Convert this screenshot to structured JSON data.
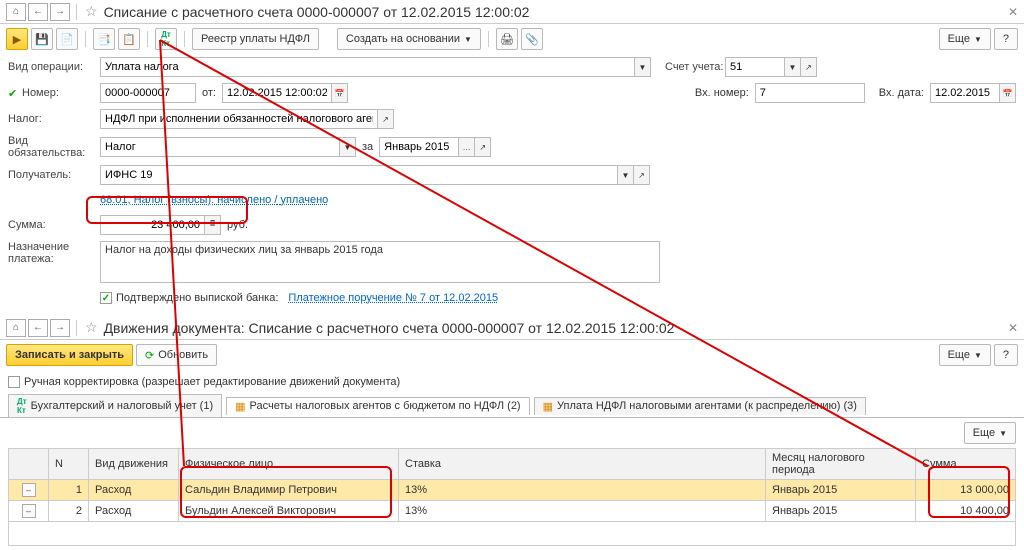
{
  "top": {
    "title": "Списание с расчетного счета 0000-000007 от 12.02.2015 12:00:02",
    "toolbar_registry": "Реестр уплаты НДФЛ",
    "toolbar_create": "Создать на основании",
    "more": "Еще",
    "help": "?",
    "op_type_label": "Вид операции:",
    "op_type_value": "Уплата налога",
    "account_label": "Счет учета:",
    "account_value": "51",
    "number_label": "Номер:",
    "number_value": "0000-000007",
    "date_label": "от:",
    "date_value": "12.02.2015 12:00:02",
    "in_number_label": "Вх. номер:",
    "in_number_value": "7",
    "in_date_label": "Вх. дата:",
    "in_date_value": "12.02.2015",
    "tax_label": "Налог:",
    "tax_value": "НДФЛ при исполнении обязанностей налогового агента",
    "liab_label": "Вид обязательства:",
    "liab_value": "Налог",
    "period_label": "за",
    "period_value": "Январь 2015",
    "recipient_label": "Получатель:",
    "recipient_value": "ИФНС 19",
    "account_link_pre": "68.01, Налог (взносы): начислено /",
    "account_link_suf": "уплачено",
    "sum_label": "Сумма:",
    "sum_value": "23 400,00",
    "rub": "руб.",
    "purpose_label": "Назначение платежа:",
    "purpose_value": "Налог на доходы физических лиц за январь 2015 года",
    "confirmed_label": "Подтверждено выпиской банка:",
    "payment_link": "Платежное поручение № 7 от 12.02.2015"
  },
  "bottom": {
    "title": "Движения документа: Списание с расчетного счета 0000-000007 от 12.02.2015 12:00:02",
    "save_close": "Записать и закрыть",
    "refresh": "Обновить",
    "more": "Еще",
    "manual_label": "Ручная корректировка (разрешает редактирование движений документа)",
    "tabs": [
      "Бухгалтерский и налоговый учет (1)",
      "Расчеты налоговых агентов с бюджетом по НДФЛ (2)",
      "Уплата НДФЛ налоговыми агентами (к распределению) (3)"
    ],
    "more2": "Еще",
    "headers": {
      "n": "N",
      "move": "Вид движения",
      "person": "Физическое лицо",
      "rate": "Ставка",
      "period": "Месяц налогового периода",
      "sum": "Сумма"
    },
    "rows": [
      {
        "n": "1",
        "move": "Расход",
        "person": "Сальдин Владимир Петрович",
        "rate": "13%",
        "period": "Январь 2015",
        "sum": "13 000,00"
      },
      {
        "n": "2",
        "move": "Расход",
        "person": "Бульдин Алексей Викторович",
        "rate": "13%",
        "period": "Январь 2015",
        "sum": "10 400,00"
      }
    ]
  }
}
